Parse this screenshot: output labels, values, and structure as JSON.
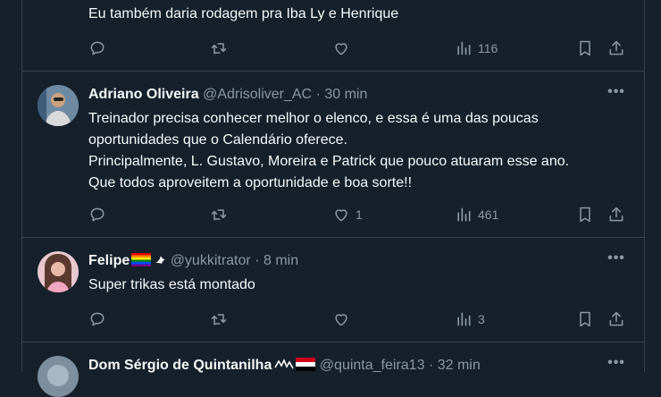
{
  "tweets": [
    {
      "text_lines": [
        "Eu também daria rodagem pra Iba Ly e Henrique"
      ],
      "views": "116",
      "replies": "",
      "retweets": "",
      "likes": ""
    },
    {
      "name": "Adriano Oliveira",
      "handle": "@Adrisoliver_AC",
      "sep": "·",
      "time": "30 min",
      "text_lines": [
        "Treinador precisa conhecer melhor o elenco, e essa é uma das poucas",
        "oportunidades que o Calendário oferece.",
        "Principalmente, L. Gustavo, Moreira e Patrick que pouco atuaram esse ano.",
        "Que todos aproveitem a oportunidade e boa sorte!!"
      ],
      "likes": "1",
      "views": "461"
    },
    {
      "name": "Felipe",
      "handle": "@yukkitrator",
      "sep": "·",
      "time": "8 min",
      "text_lines": [
        "Super trikas está montado"
      ],
      "likes": "",
      "views": "3"
    },
    {
      "name": "Dom Sérgio de Quintanilha",
      "handle": "@quinta_feira13",
      "sep": "·",
      "time": "32 min"
    }
  ],
  "icons": [
    "reply-icon",
    "retweet-icon",
    "like-icon",
    "views-icon",
    "bookmark-icon",
    "share-icon",
    "more-icon"
  ],
  "colors": {
    "background": "#15202b",
    "border": "#38444d",
    "muted": "#8b98a5",
    "text": "#f7f9f9"
  }
}
